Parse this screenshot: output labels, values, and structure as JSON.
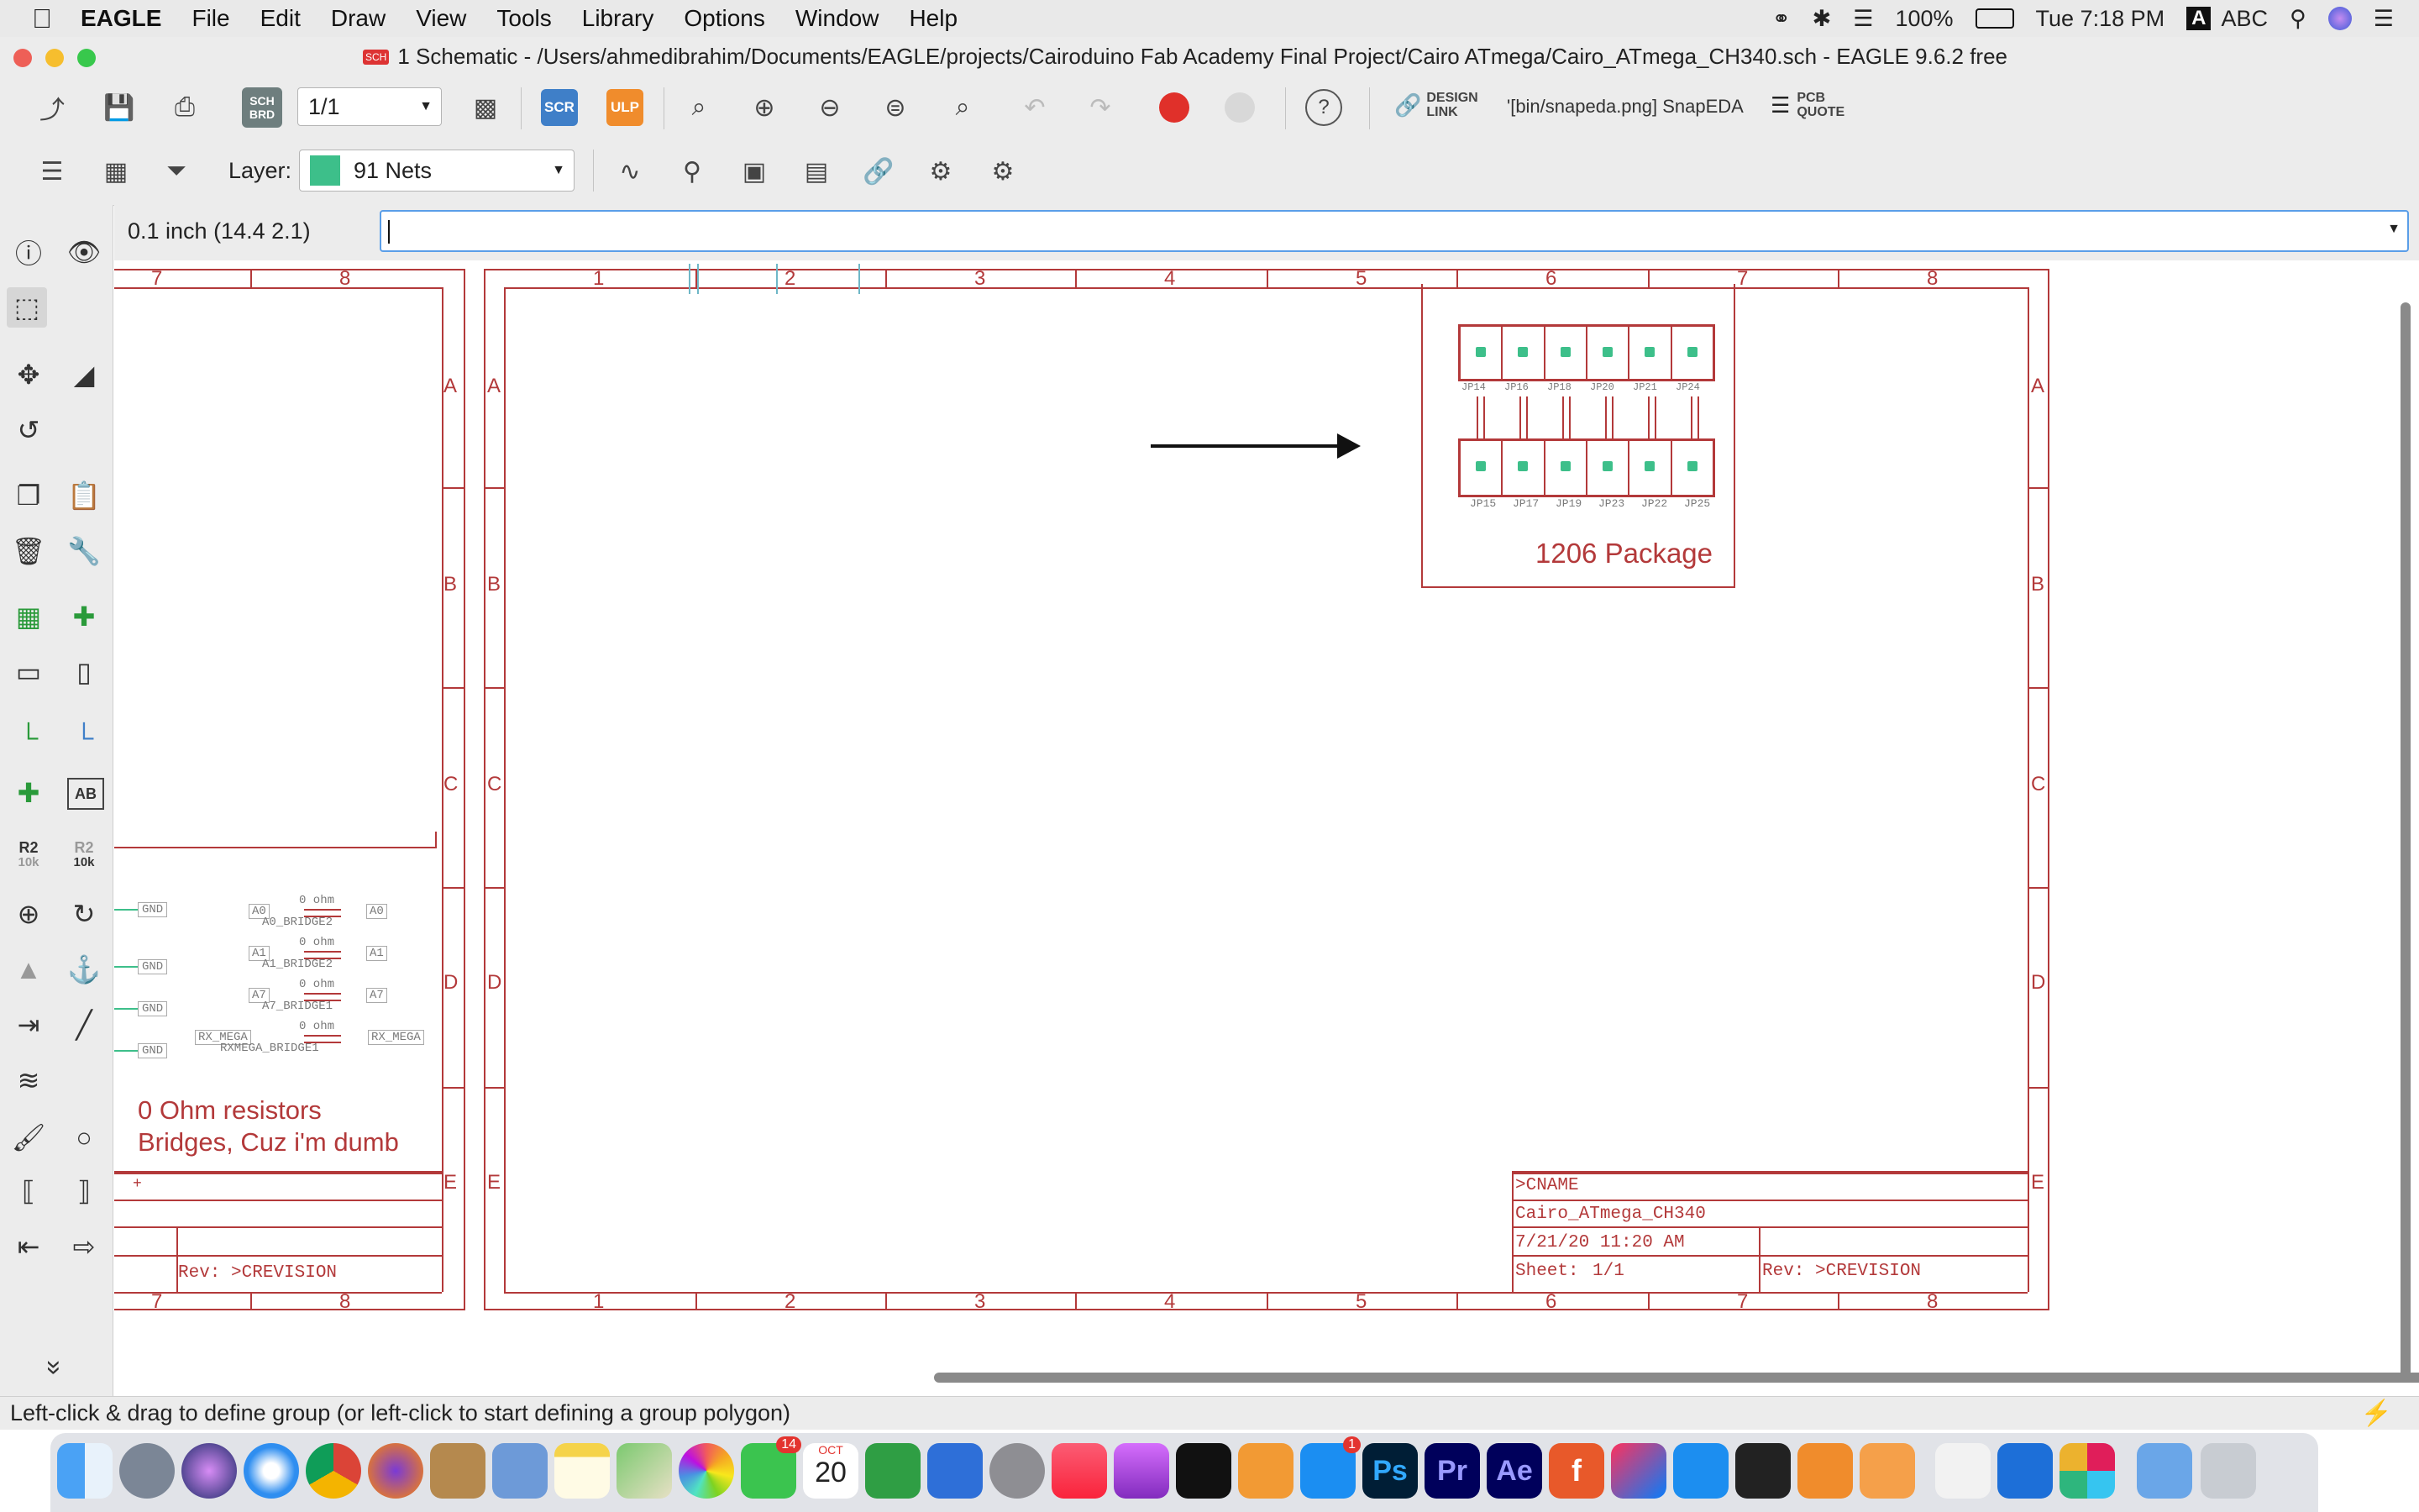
{
  "menubar": {
    "app": "EAGLE",
    "items": [
      "File",
      "Edit",
      "Draw",
      "View",
      "Tools",
      "Library",
      "Options",
      "Window",
      "Help"
    ],
    "battery": "100%",
    "datetime": "Tue 7:18 PM",
    "input_source_letter": "A",
    "input_source": "ABC"
  },
  "window": {
    "title": "1 Schematic - /Users/ahmedibrahim/Documents/EAGLE/projects/Cairoduino Fab Academy Final Project/Cairo ATmega/Cairo_ATmega_CH340.sch - EAGLE 9.6.2 free",
    "doc_badge": "SCH"
  },
  "toolbar1": {
    "sch_brd_top": "SCH",
    "sch_brd_bottom": "BRD",
    "sheet_select": "1/1",
    "scr_label": "SCR",
    "ulp_label": "ULP",
    "help_label": "?",
    "design_link_top": "DESIGN",
    "design_link_bottom": "LINK",
    "snapeda_label": "'[bin/snapeda.png] SnapEDA",
    "pcb_quote_top": "PCB",
    "pcb_quote_bottom": "QUOTE"
  },
  "toolbar2": {
    "layer_label": "Layer:",
    "layer_value": "91 Nets",
    "layer_color": "#3dbf8a"
  },
  "command": {
    "grid_readout": "0.1 inch (14.4 2.1)",
    "input_value": ""
  },
  "palette": {
    "r2_top": "R2",
    "r2_bottom": "10k",
    "r2b_top": "R2",
    "r2b_bottom": "10k",
    "ab_label": "AB",
    "expand_label": "»"
  },
  "schematic": {
    "left_frame_cols": [
      "7",
      "8"
    ],
    "right_frame_cols": [
      "1",
      "2",
      "3",
      "4",
      "5",
      "6",
      "7",
      "8"
    ],
    "rows": [
      "A",
      "B",
      "C",
      "D",
      "E"
    ],
    "package_label": "1206 Package",
    "jumpers_top": [
      "JP14",
      "JP16",
      "JP18",
      "JP20",
      "JP21",
      "JP24"
    ],
    "jumpers_bottom": [
      "JP15",
      "JP17",
      "JP19",
      "JP23",
      "JP22",
      "JP25"
    ],
    "resistor_note_line1": "0 Ohm resistors",
    "resistor_note_line2": "Bridges, Cuz i'm dumb",
    "bridges": [
      {
        "net_left": "A0",
        "value": "0 ohm",
        "name": "A0_BRIDGE2",
        "net_right": "A0"
      },
      {
        "net_left": "A1",
        "value": "0 ohm",
        "name": "A1_BRIDGE2",
        "net_right": "A1"
      },
      {
        "net_left": "A7",
        "value": "0 ohm",
        "name": "A7_BRIDGE1",
        "net_right": "A7"
      },
      {
        "net_left": "RX_MEGA",
        "value": "0 ohm",
        "name": "RXMEGA_BRIDGE1",
        "net_right": "RX_MEGA"
      }
    ],
    "gnd_label": "GND",
    "left_rev": "Rev:  >CREVISION",
    "left_plus": "+",
    "titleblock": {
      "name": ">CNAME",
      "file": "Cairo_ATmega_CH340",
      "date": "7/21/20 11:20 AM",
      "sheet_label": "Sheet:",
      "sheet_value": "1/1",
      "rev": "Rev: >CREVISION"
    }
  },
  "status": {
    "message": "Left-click & drag to define group (or left-click to start defining a group polygon)"
  },
  "dock": {
    "mail_badge": "14",
    "calendar_month": "OCT",
    "calendar_day": "20",
    "appstore_badge": "1",
    "ps": "Ps",
    "pr": "Pr",
    "ae": "Ae",
    "f360": "f"
  }
}
